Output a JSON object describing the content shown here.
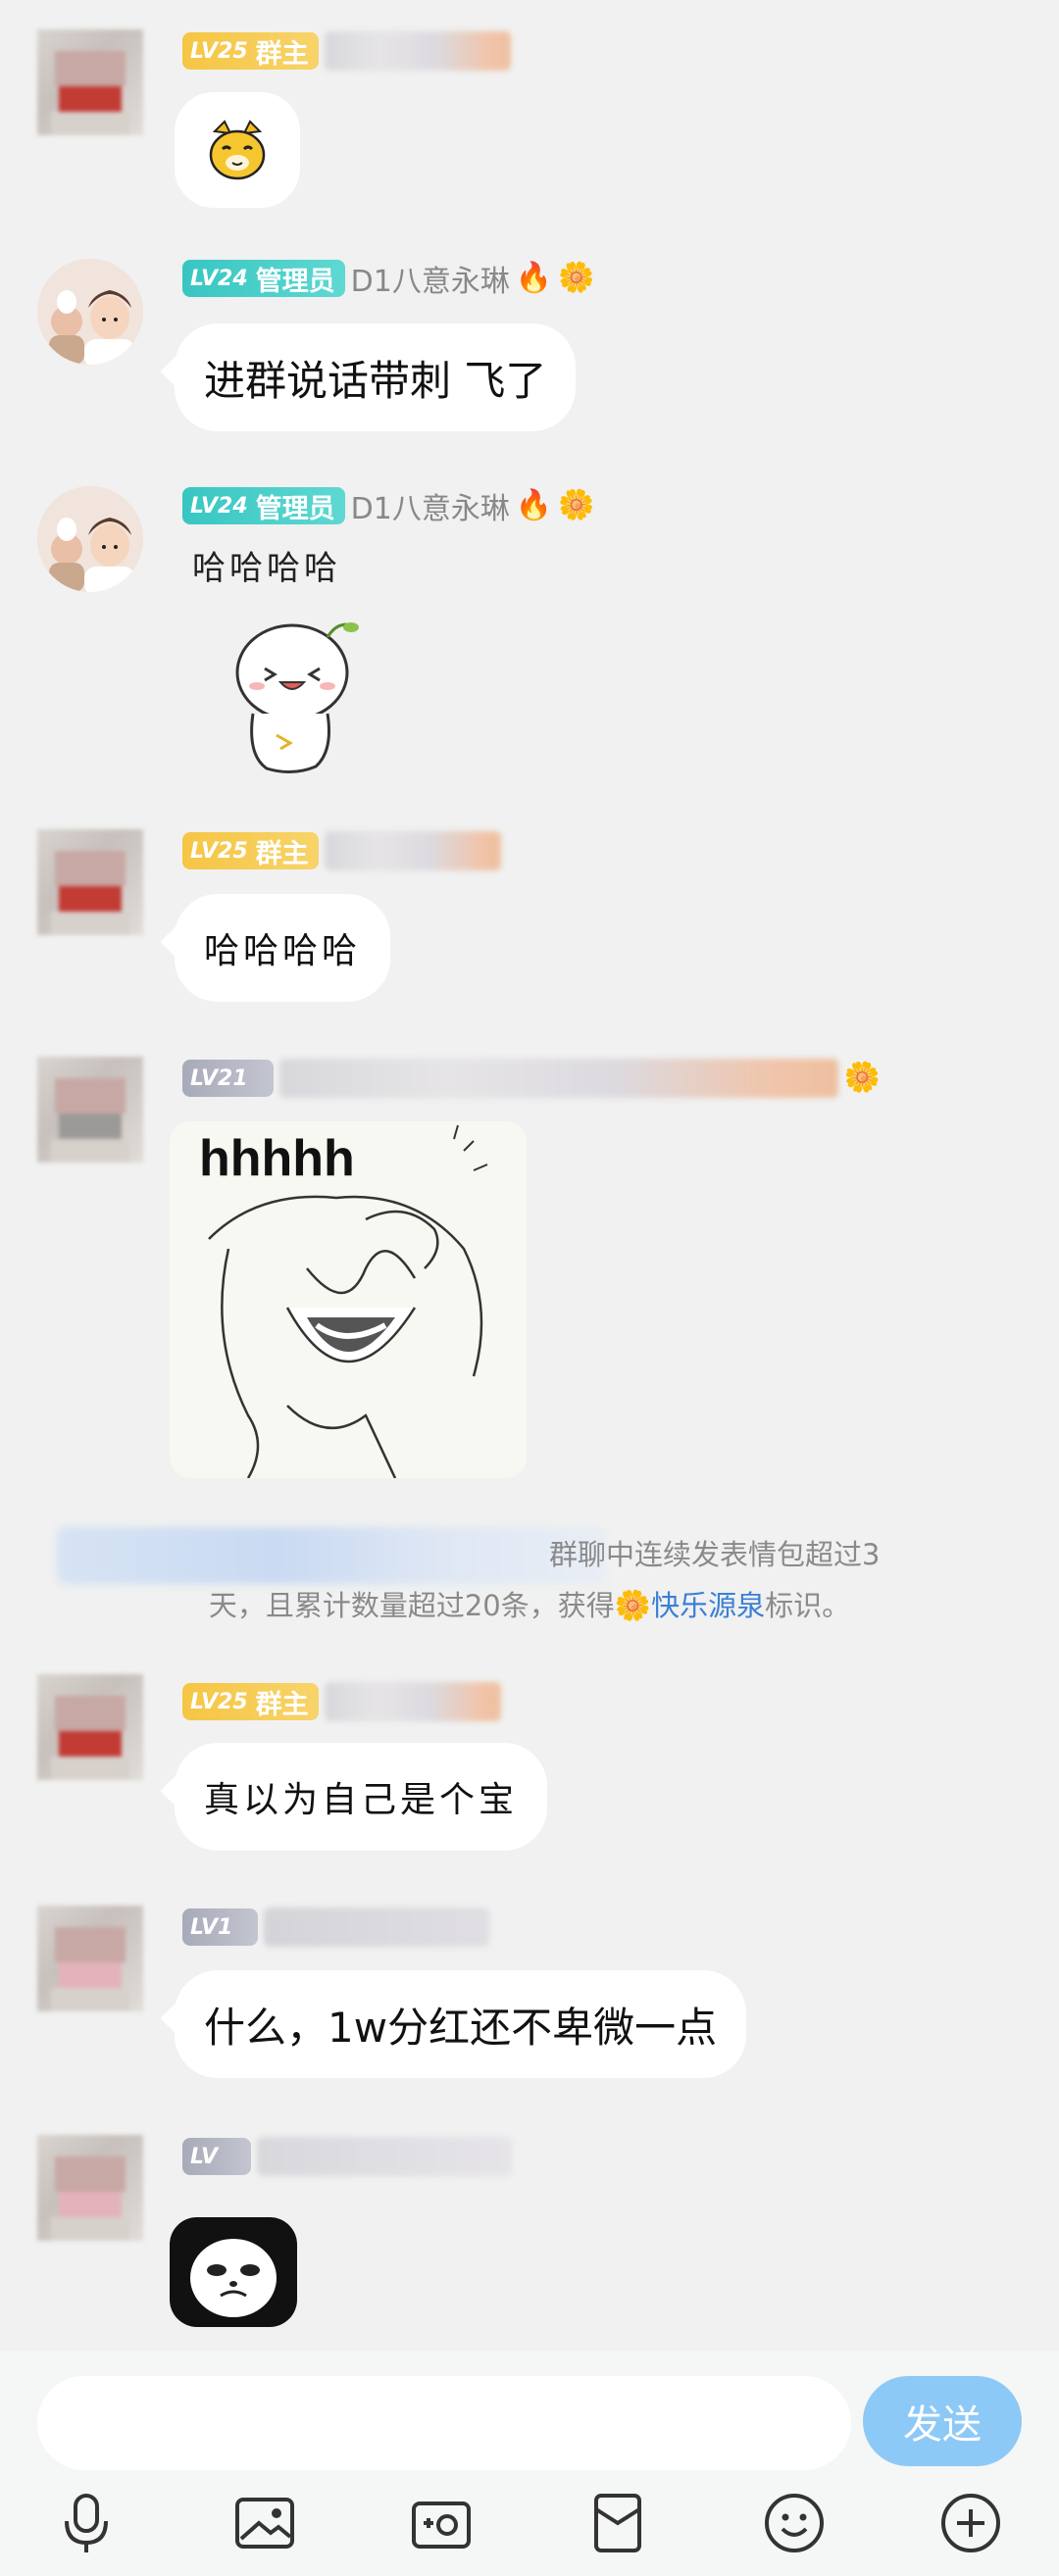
{
  "messages": [
    {
      "role": "owner",
      "level_prefix": "LV",
      "level": "25",
      "role_label": "群主"
    },
    {
      "role": "admin",
      "level_prefix": "LV",
      "level": "24",
      "role_label": "管理员",
      "name": "D1八意永琳",
      "text": "进群说话带刺 飞了"
    },
    {
      "role": "admin",
      "level_prefix": "LV",
      "level": "24",
      "role_label": "管理员",
      "name": "D1八意永琳",
      "text": "哈哈哈哈"
    },
    {
      "role": "owner",
      "level_prefix": "LV",
      "level": "25",
      "role_label": "群主",
      "text": "哈哈哈哈"
    },
    {
      "role": "member",
      "level_prefix": "LV",
      "level": "21",
      "image_caption": "hhhhh"
    },
    {
      "role": "owner",
      "level_prefix": "LV",
      "level": "25",
      "role_label": "群主",
      "text": "真以为自己是个宝"
    },
    {
      "role": "member",
      "level_prefix": "LV",
      "level": "1",
      "text": "什么，1w分红还不卑微一点"
    },
    {
      "role": "member",
      "level_prefix": "LV"
    }
  ],
  "system_notice": {
    "line1": "群聊中连续发表情包超过3",
    "line2_prefix": "天，且累计数量超过20条，获得",
    "badge_name": "快乐源泉",
    "line2_suffix": "标识。"
  },
  "input_bar": {
    "send_label": "发送",
    "tools": [
      "microphone-icon",
      "image-icon",
      "camera-icon",
      "red-packet-icon",
      "emoji-icon",
      "plus-icon"
    ]
  },
  "colors": {
    "owner_badge": "#f6c544",
    "admin_badge": "#38c6c2",
    "member_badge": "#a7aab8",
    "link_blue": "#3b7fd6",
    "send_button": "#8dc9f7"
  }
}
